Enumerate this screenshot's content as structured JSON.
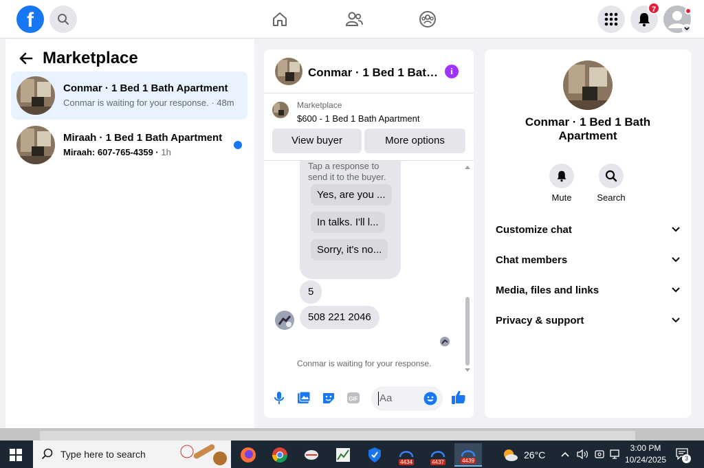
{
  "colors": {
    "brand": "#1877f2",
    "active_row": "#e7f3ff",
    "info_purple": "#a033ff",
    "badge_red": "#e41e3f"
  },
  "topbar": {
    "logo_letter": "f",
    "notifications_count": "7"
  },
  "left_panel": {
    "title": "Marketplace",
    "conversations": [
      {
        "title": "Conmar · 1 Bed 1 Bath Apartment",
        "subtitle": "Conmar is waiting for your response.",
        "time": "48m",
        "unread": false,
        "active": true
      },
      {
        "title": "Miraah · 1 Bed 1 Bath Apartment",
        "subtitle": "Miraah: 607-765-4359",
        "time": "1h",
        "unread": true,
        "active": false
      }
    ]
  },
  "chat": {
    "title": "Conmar · 1 Bed 1 Bath Apartment",
    "listing": {
      "source": "Marketplace",
      "name": "$600 - 1 Bed 1 Bath Apartment",
      "view_buyer_label": "View buyer",
      "more_options_label": "More options"
    },
    "prompt_text": "Tap a response to send it to the buyer.",
    "quick_replies": [
      "Yes, are you ...",
      "In talks. I'll l...",
      "Sorry, it's no..."
    ],
    "messages": [
      "5",
      "508 221 2046"
    ],
    "waiting_note": "Conmar is waiting for your response.",
    "composer_placeholder": "Aa"
  },
  "right_panel": {
    "title": "Conmar · 1 Bed 1 Bath Apartment",
    "actions": [
      {
        "label": "Mute",
        "icon": "bell-icon"
      },
      {
        "label": "Search",
        "icon": "search-icon"
      }
    ],
    "sections": [
      "Customize chat",
      "Chat members",
      "Media, files and links",
      "Privacy & support"
    ]
  },
  "taskbar": {
    "search_placeholder": "Type here to search",
    "app_counts": [
      "4434",
      "4437",
      "4439"
    ],
    "temperature": "26°C",
    "time": "3:00 PM",
    "date": "10/24/2025",
    "notification_count": "3"
  }
}
